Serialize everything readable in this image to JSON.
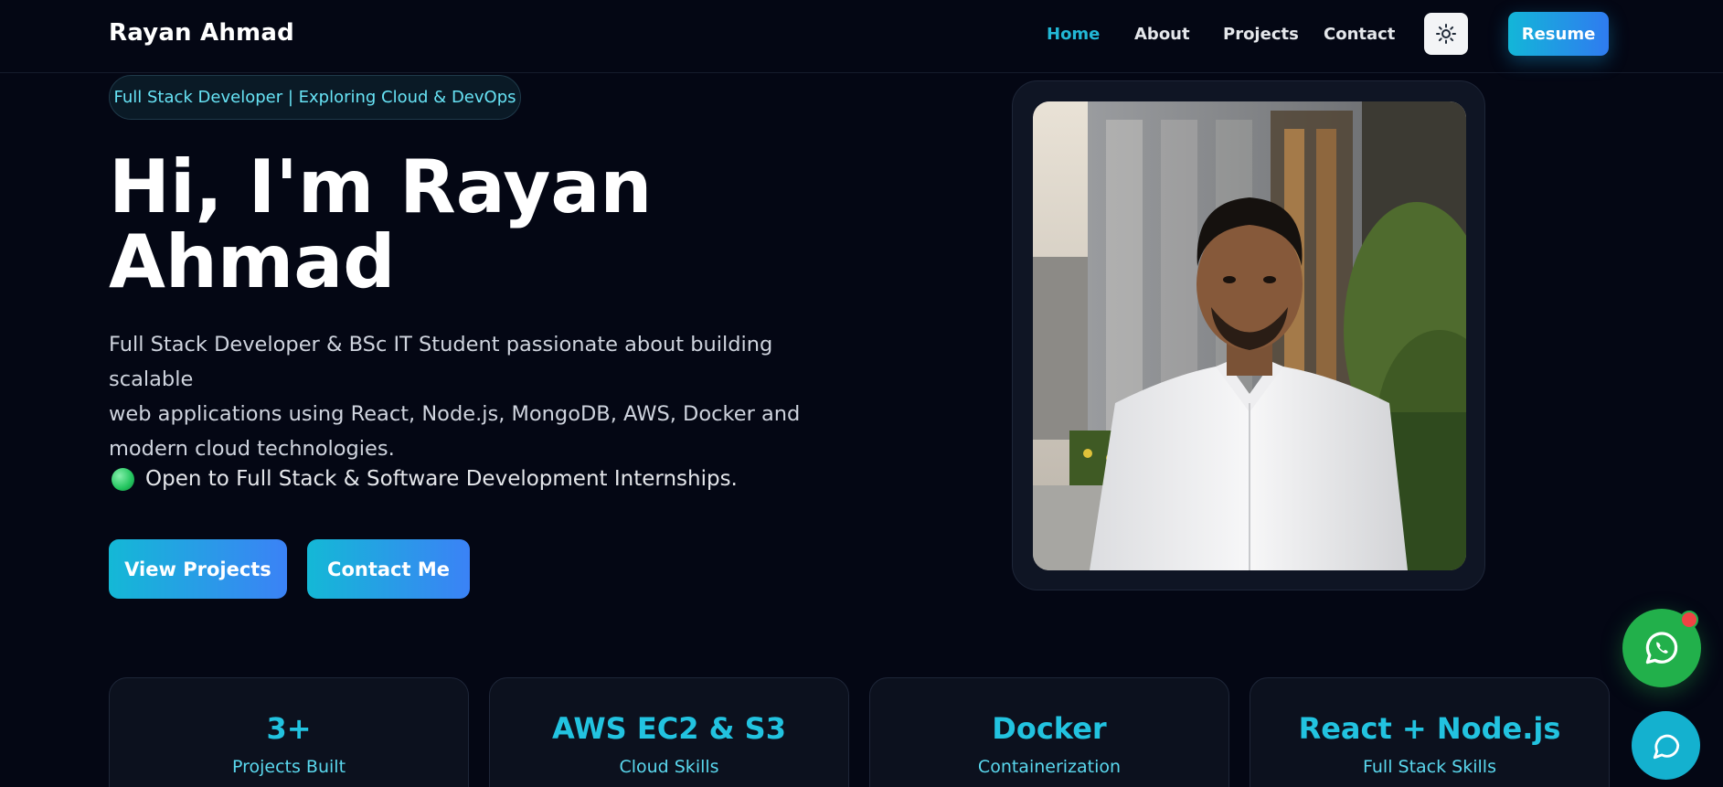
{
  "header": {
    "brand": "Rayan Ahmad",
    "nav": [
      {
        "label": "Home",
        "active": true
      },
      {
        "label": "About",
        "active": false
      },
      {
        "label": "Projects",
        "active": false
      },
      {
        "label": "Contact",
        "active": false
      }
    ],
    "theme_toggle_icon": "sun-icon",
    "resume_label": "Resume"
  },
  "hero": {
    "badge": "Full Stack Developer | Exploring Cloud & DevOps",
    "title_line1": "Hi, I'm Rayan",
    "title_line2": "Ahmad",
    "description_line1": "Full Stack Developer & BSc IT Student passionate about building scalable",
    "description_line2": "web applications using React, Node.js, MongoDB, AWS, Docker and",
    "description_line3": "modern cloud technologies.",
    "availability": "Open to Full Stack & Software Development Internships.",
    "buttons": {
      "view_projects": "View Projects",
      "contact_me": "Contact Me"
    }
  },
  "stats": [
    {
      "value": "3+",
      "label": "Projects Built"
    },
    {
      "value": "AWS EC2 & S3",
      "label": "Cloud Skills"
    },
    {
      "value": "Docker",
      "label": "Containerization"
    },
    {
      "value": "React + Node.js",
      "label": "Full Stack Skills"
    }
  ],
  "floating": {
    "whatsapp_icon": "whatsapp-icon",
    "chat_icon": "chat-bubble-icon"
  },
  "colors": {
    "background": "#040714",
    "accent": "#22b8d6",
    "gradient_start": "#14b8d6",
    "gradient_end": "#3b82f6",
    "whatsapp": "#22b04b",
    "notification": "#ef4444"
  }
}
